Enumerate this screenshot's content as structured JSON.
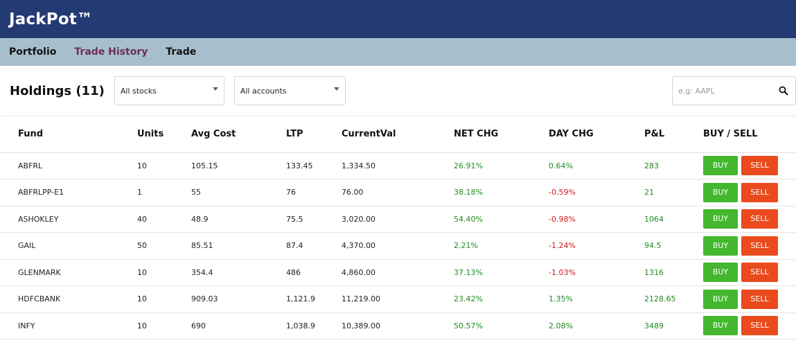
{
  "app": {
    "title": "JackPot™"
  },
  "nav": {
    "items": [
      "Portfolio",
      "Trade History",
      "Trade"
    ]
  },
  "holdings": {
    "title": "Holdings (11)",
    "stock_filter": "All stocks",
    "account_filter": "All accounts",
    "search_placeholder": "e.g: AAPL"
  },
  "colors": {
    "header_bg": "#243a73",
    "nav_bg": "#a7bfcd",
    "active_nav": "#6e2d5a",
    "positive": "#1f8a1f",
    "negative": "#d21a1a",
    "buy": "#43b72e",
    "sell": "#ea4a1d"
  },
  "table": {
    "columns": [
      "Fund",
      "Units",
      "Avg Cost",
      "LTP",
      "CurrentVal",
      "NET CHG",
      "DAY CHG",
      "P&L",
      "BUY / SELL"
    ],
    "buy_label": "BUY",
    "sell_label": "SELL",
    "rows": [
      {
        "fund": "ABFRL",
        "units": "10",
        "avg_cost": "105.15",
        "ltp": "133.45",
        "current_val": "1,334.50",
        "net_chg": "26.91%",
        "day_chg": "0.64%",
        "day_dir": "up",
        "pnl": "283"
      },
      {
        "fund": "ABFRLPP-E1",
        "units": "1",
        "avg_cost": "55",
        "ltp": "76",
        "current_val": "76.00",
        "net_chg": "38.18%",
        "day_chg": "-0.59%",
        "day_dir": "down",
        "pnl": "21"
      },
      {
        "fund": "ASHOKLEY",
        "units": "40",
        "avg_cost": "48.9",
        "ltp": "75.5",
        "current_val": "3,020.00",
        "net_chg": "54.40%",
        "day_chg": "-0.98%",
        "day_dir": "down",
        "pnl": "1064"
      },
      {
        "fund": "GAIL",
        "units": "50",
        "avg_cost": "85.51",
        "ltp": "87.4",
        "current_val": "4,370.00",
        "net_chg": "2.21%",
        "day_chg": "-1.24%",
        "day_dir": "down",
        "pnl": "94.5"
      },
      {
        "fund": "GLENMARK",
        "units": "10",
        "avg_cost": "354.4",
        "ltp": "486",
        "current_val": "4,860.00",
        "net_chg": "37.13%",
        "day_chg": "-1.03%",
        "day_dir": "down",
        "pnl": "1316"
      },
      {
        "fund": "HDFCBANK",
        "units": "10",
        "avg_cost": "909.03",
        "ltp": "1,121.9",
        "current_val": "11,219.00",
        "net_chg": "23.42%",
        "day_chg": "1.35%",
        "day_dir": "up",
        "pnl": "2128.65"
      },
      {
        "fund": "INFY",
        "units": "10",
        "avg_cost": "690",
        "ltp": "1,038.9",
        "current_val": "10,389.00",
        "net_chg": "50.57%",
        "day_chg": "2.08%",
        "day_dir": "up",
        "pnl": "3489"
      }
    ]
  }
}
